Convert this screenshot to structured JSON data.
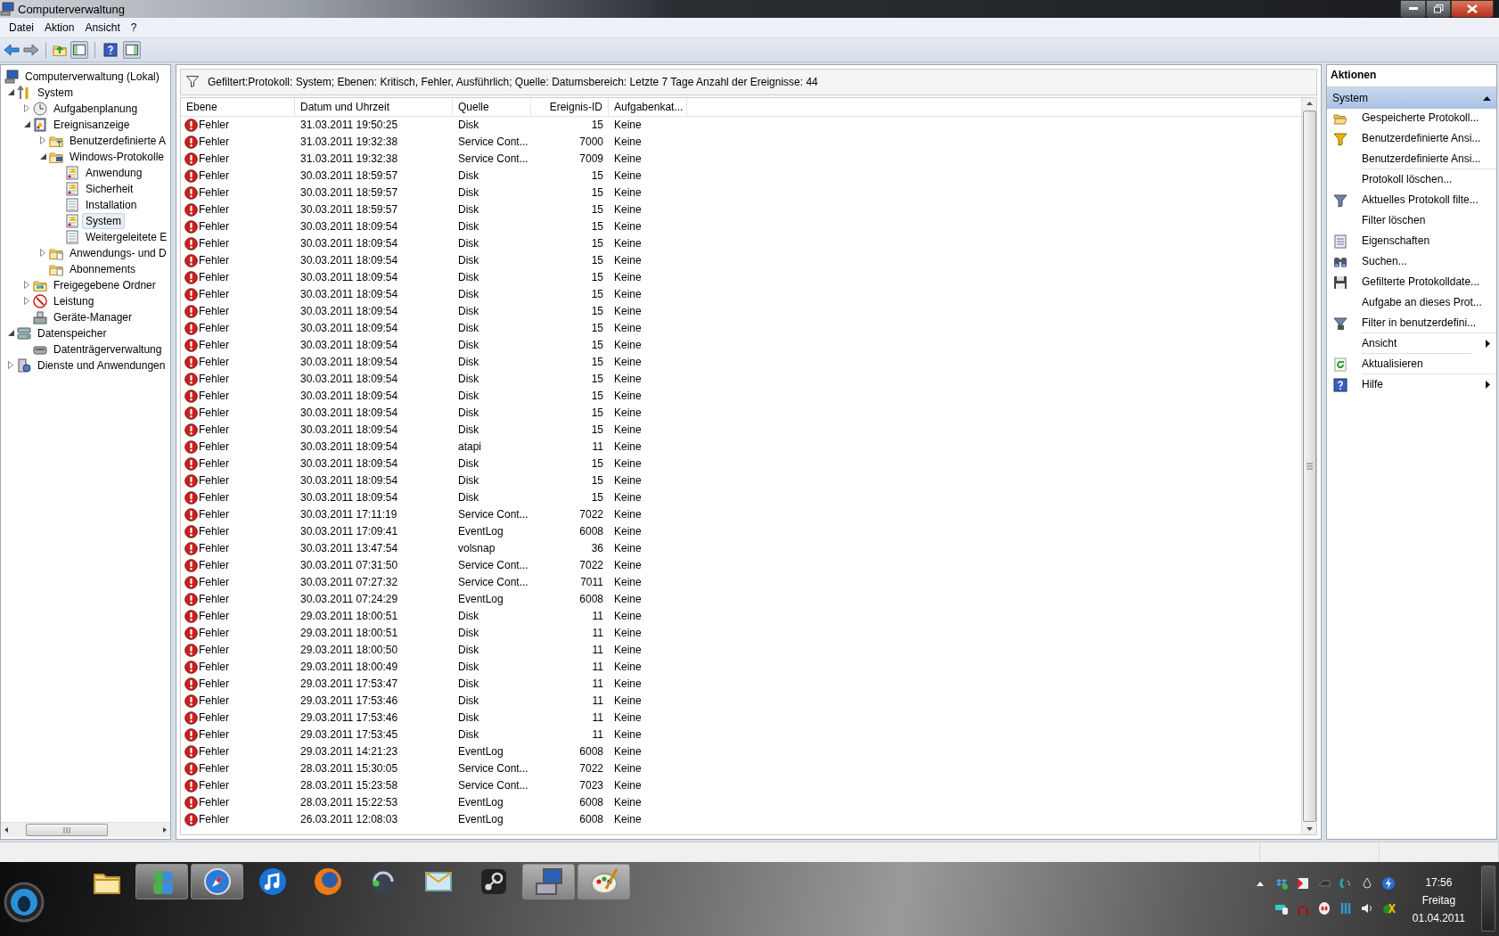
{
  "window": {
    "title": "Computerverwaltung"
  },
  "menu": [
    "Datei",
    "Aktion",
    "Ansicht",
    "?"
  ],
  "tree": [
    {
      "label": "Computerverwaltung (Lokal)",
      "kind": "computer",
      "expandable": false,
      "selected": false,
      "children": [
        {
          "label": "System",
          "kind": "tools",
          "expandable": true,
          "expanded": true,
          "selected": false,
          "children": [
            {
              "label": "Aufgabenplanung",
              "kind": "clock",
              "expandable": true,
              "expanded": false,
              "selected": false
            },
            {
              "label": "Ereignisanzeige",
              "kind": "viewer",
              "expandable": true,
              "expanded": true,
              "selected": false,
              "children": [
                {
                  "label": "Benutzerdefinierte A",
                  "kind": "folder-filter",
                  "expandable": true,
                  "expanded": false,
                  "selected": false
                },
                {
                  "label": "Windows-Protokolle",
                  "kind": "folder-computer",
                  "expandable": true,
                  "expanded": true,
                  "selected": false,
                  "children": [
                    {
                      "label": "Anwendung",
                      "kind": "log-alert",
                      "expandable": false,
                      "selected": false
                    },
                    {
                      "label": "Sicherheit",
                      "kind": "log-alert",
                      "expandable": false,
                      "selected": false
                    },
                    {
                      "label": "Installation",
                      "kind": "log",
                      "expandable": false,
                      "selected": false
                    },
                    {
                      "label": "System",
                      "kind": "log-alert",
                      "expandable": false,
                      "selected": true
                    },
                    {
                      "label": "Weitergeleitete E",
                      "kind": "log",
                      "expandable": false,
                      "selected": false
                    }
                  ]
                },
                {
                  "label": "Anwendungs- und D",
                  "kind": "folder-doc",
                  "expandable": true,
                  "expanded": false,
                  "selected": false
                },
                {
                  "label": "Abonnements",
                  "kind": "folder-doc",
                  "expandable": false,
                  "selected": false
                }
              ]
            },
            {
              "label": "Freigegebene Ordner",
              "kind": "folder-shared",
              "expandable": true,
              "expanded": false,
              "selected": false
            },
            {
              "label": "Leistung",
              "kind": "gauge",
              "expandable": true,
              "expanded": false,
              "selected": false
            },
            {
              "label": "Geräte-Manager",
              "kind": "device",
              "expandable": false,
              "selected": false
            }
          ]
        },
        {
          "label": "Datenspeicher",
          "kind": "storage",
          "expandable": true,
          "expanded": true,
          "selected": false,
          "children": [
            {
              "label": "Datenträgerverwaltung",
              "kind": "disk",
              "expandable": false,
              "selected": false
            }
          ]
        },
        {
          "label": "Dienste und Anwendungen",
          "kind": "services",
          "expandable": true,
          "expanded": false,
          "selected": false
        }
      ]
    }
  ],
  "filter_text": "Gefiltert:Protokoll: System; Ebenen: Kritisch, Fehler, Ausführlich; Quelle: Datumsbereich: Letzte 7 Tage Anzahl der Ereignisse: 44",
  "table": {
    "columns": [
      "Ebene",
      "Datum und Uhrzeit",
      "Quelle",
      "Ereignis-ID",
      "Aufgabenkat..."
    ],
    "rows": [
      {
        "ebene": "Fehler",
        "datum": "31.03.2011 19:50:25",
        "quelle": "Disk",
        "id": "15",
        "kategorie": "Keine"
      },
      {
        "ebene": "Fehler",
        "datum": "31.03.2011 19:32:38",
        "quelle": "Service Cont...",
        "id": "7000",
        "kategorie": "Keine"
      },
      {
        "ebene": "Fehler",
        "datum": "31.03.2011 19:32:38",
        "quelle": "Service Cont...",
        "id": "7009",
        "kategorie": "Keine"
      },
      {
        "ebene": "Fehler",
        "datum": "30.03.2011 18:59:57",
        "quelle": "Disk",
        "id": "15",
        "kategorie": "Keine"
      },
      {
        "ebene": "Fehler",
        "datum": "30.03.2011 18:59:57",
        "quelle": "Disk",
        "id": "15",
        "kategorie": "Keine"
      },
      {
        "ebene": "Fehler",
        "datum": "30.03.2011 18:59:57",
        "quelle": "Disk",
        "id": "15",
        "kategorie": "Keine"
      },
      {
        "ebene": "Fehler",
        "datum": "30.03.2011 18:09:54",
        "quelle": "Disk",
        "id": "15",
        "kategorie": "Keine"
      },
      {
        "ebene": "Fehler",
        "datum": "30.03.2011 18:09:54",
        "quelle": "Disk",
        "id": "15",
        "kategorie": "Keine"
      },
      {
        "ebene": "Fehler",
        "datum": "30.03.2011 18:09:54",
        "quelle": "Disk",
        "id": "15",
        "kategorie": "Keine"
      },
      {
        "ebene": "Fehler",
        "datum": "30.03.2011 18:09:54",
        "quelle": "Disk",
        "id": "15",
        "kategorie": "Keine"
      },
      {
        "ebene": "Fehler",
        "datum": "30.03.2011 18:09:54",
        "quelle": "Disk",
        "id": "15",
        "kategorie": "Keine"
      },
      {
        "ebene": "Fehler",
        "datum": "30.03.2011 18:09:54",
        "quelle": "Disk",
        "id": "15",
        "kategorie": "Keine"
      },
      {
        "ebene": "Fehler",
        "datum": "30.03.2011 18:09:54",
        "quelle": "Disk",
        "id": "15",
        "kategorie": "Keine"
      },
      {
        "ebene": "Fehler",
        "datum": "30.03.2011 18:09:54",
        "quelle": "Disk",
        "id": "15",
        "kategorie": "Keine"
      },
      {
        "ebene": "Fehler",
        "datum": "30.03.2011 18:09:54",
        "quelle": "Disk",
        "id": "15",
        "kategorie": "Keine"
      },
      {
        "ebene": "Fehler",
        "datum": "30.03.2011 18:09:54",
        "quelle": "Disk",
        "id": "15",
        "kategorie": "Keine"
      },
      {
        "ebene": "Fehler",
        "datum": "30.03.2011 18:09:54",
        "quelle": "Disk",
        "id": "15",
        "kategorie": "Keine"
      },
      {
        "ebene": "Fehler",
        "datum": "30.03.2011 18:09:54",
        "quelle": "Disk",
        "id": "15",
        "kategorie": "Keine"
      },
      {
        "ebene": "Fehler",
        "datum": "30.03.2011 18:09:54",
        "quelle": "Disk",
        "id": "15",
        "kategorie": "Keine"
      },
      {
        "ebene": "Fehler",
        "datum": "30.03.2011 18:09:54",
        "quelle": "atapi",
        "id": "11",
        "kategorie": "Keine"
      },
      {
        "ebene": "Fehler",
        "datum": "30.03.2011 18:09:54",
        "quelle": "Disk",
        "id": "15",
        "kategorie": "Keine"
      },
      {
        "ebene": "Fehler",
        "datum": "30.03.2011 18:09:54",
        "quelle": "Disk",
        "id": "15",
        "kategorie": "Keine"
      },
      {
        "ebene": "Fehler",
        "datum": "30.03.2011 18:09:54",
        "quelle": "Disk",
        "id": "15",
        "kategorie": "Keine"
      },
      {
        "ebene": "Fehler",
        "datum": "30.03.2011 17:11:19",
        "quelle": "Service Cont...",
        "id": "7022",
        "kategorie": "Keine"
      },
      {
        "ebene": "Fehler",
        "datum": "30.03.2011 17:09:41",
        "quelle": "EventLog",
        "id": "6008",
        "kategorie": "Keine"
      },
      {
        "ebene": "Fehler",
        "datum": "30.03.2011 13:47:54",
        "quelle": "volsnap",
        "id": "36",
        "kategorie": "Keine"
      },
      {
        "ebene": "Fehler",
        "datum": "30.03.2011 07:31:50",
        "quelle": "Service Cont...",
        "id": "7022",
        "kategorie": "Keine"
      },
      {
        "ebene": "Fehler",
        "datum": "30.03.2011 07:27:32",
        "quelle": "Service Cont...",
        "id": "7011",
        "kategorie": "Keine"
      },
      {
        "ebene": "Fehler",
        "datum": "30.03.2011 07:24:29",
        "quelle": "EventLog",
        "id": "6008",
        "kategorie": "Keine"
      },
      {
        "ebene": "Fehler",
        "datum": "29.03.2011 18:00:51",
        "quelle": "Disk",
        "id": "11",
        "kategorie": "Keine"
      },
      {
        "ebene": "Fehler",
        "datum": "29.03.2011 18:00:51",
        "quelle": "Disk",
        "id": "11",
        "kategorie": "Keine"
      },
      {
        "ebene": "Fehler",
        "datum": "29.03.2011 18:00:50",
        "quelle": "Disk",
        "id": "11",
        "kategorie": "Keine"
      },
      {
        "ebene": "Fehler",
        "datum": "29.03.2011 18:00:49",
        "quelle": "Disk",
        "id": "11",
        "kategorie": "Keine"
      },
      {
        "ebene": "Fehler",
        "datum": "29.03.2011 17:53:47",
        "quelle": "Disk",
        "id": "11",
        "kategorie": "Keine"
      },
      {
        "ebene": "Fehler",
        "datum": "29.03.2011 17:53:46",
        "quelle": "Disk",
        "id": "11",
        "kategorie": "Keine"
      },
      {
        "ebene": "Fehler",
        "datum": "29.03.2011 17:53:46",
        "quelle": "Disk",
        "id": "11",
        "kategorie": "Keine"
      },
      {
        "ebene": "Fehler",
        "datum": "29.03.2011 17:53:45",
        "quelle": "Disk",
        "id": "11",
        "kategorie": "Keine"
      },
      {
        "ebene": "Fehler",
        "datum": "29.03.2011 14:21:23",
        "quelle": "EventLog",
        "id": "6008",
        "kategorie": "Keine"
      },
      {
        "ebene": "Fehler",
        "datum": "28.03.2011 15:30:05",
        "quelle": "Service Cont...",
        "id": "7022",
        "kategorie": "Keine"
      },
      {
        "ebene": "Fehler",
        "datum": "28.03.2011 15:23:58",
        "quelle": "Service Cont...",
        "id": "7023",
        "kategorie": "Keine"
      },
      {
        "ebene": "Fehler",
        "datum": "28.03.2011 15:22:53",
        "quelle": "EventLog",
        "id": "6008",
        "kategorie": "Keine"
      },
      {
        "ebene": "Fehler",
        "datum": "26.03.2011 12:08:03",
        "quelle": "EventLog",
        "id": "6008",
        "kategorie": "Keine"
      }
    ]
  },
  "actions": {
    "title": "Aktionen",
    "section": "System",
    "section_expanded": true,
    "items": [
      {
        "label": "Gespeicherte Protokoll...",
        "kind": "folder-open",
        "submenu": false,
        "divider_after": false
      },
      {
        "label": "Benutzerdefinierte Ansi...",
        "kind": "filter-yellow",
        "submenu": false,
        "divider_after": false
      },
      {
        "label": "Benutzerdefinierte Ansi...",
        "kind": "none",
        "submenu": false,
        "divider_after": true
      },
      {
        "label": "Protokoll löschen...",
        "kind": "none",
        "submenu": false,
        "divider_after": false
      },
      {
        "label": "Aktuelles Protokoll filte...",
        "kind": "filter",
        "submenu": false,
        "divider_after": false
      },
      {
        "label": "Filter löschen",
        "kind": "none",
        "submenu": false,
        "divider_after": false
      },
      {
        "label": "Eigenschaften",
        "kind": "properties",
        "submenu": false,
        "divider_after": false
      },
      {
        "label": "Suchen...",
        "kind": "binoculars",
        "submenu": false,
        "divider_after": false
      },
      {
        "label": "Gefilterte Protokolldate...",
        "kind": "floppy",
        "submenu": false,
        "divider_after": false
      },
      {
        "label": "Aufgabe an dieses Prot...",
        "kind": "none",
        "submenu": false,
        "divider_after": false
      },
      {
        "label": "Filter in benutzerdefini...",
        "kind": "filter-save",
        "submenu": false,
        "divider_after": true
      },
      {
        "label": "Ansicht",
        "kind": "none",
        "submenu": true,
        "divider_after": true
      },
      {
        "label": "Aktualisieren",
        "kind": "refresh",
        "submenu": false,
        "divider_after": true
      },
      {
        "label": "Hilfe",
        "kind": "help",
        "submenu": true,
        "divider_after": false
      }
    ]
  },
  "taskbar": {
    "apps": [
      {
        "kind": "folder",
        "running": false
      },
      {
        "kind": "people",
        "running": true
      },
      {
        "kind": "compass",
        "running": true
      },
      {
        "kind": "music",
        "running": false
      },
      {
        "kind": "browser",
        "running": false
      },
      {
        "kind": "headset",
        "running": false
      },
      {
        "kind": "mail",
        "running": false
      },
      {
        "kind": "steam",
        "running": false
      },
      {
        "kind": "computer",
        "running": true
      },
      {
        "kind": "palette",
        "running": true
      }
    ],
    "clock": {
      "time": "17:56",
      "day": "Freitag",
      "date": "01.04.2011"
    }
  }
}
